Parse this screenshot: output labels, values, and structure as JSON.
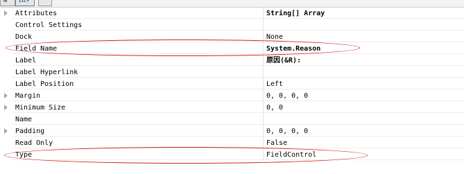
{
  "toolbar": {
    "buttons": [
      {
        "name": "categorized-view-button",
        "icon": "categorized-icon",
        "glyph": "⊞"
      },
      {
        "name": "alphabetical-view-button",
        "icon": "sort-az-icon",
        "glyph": "ǲ▾"
      },
      {
        "name": "property-pages-button",
        "icon": "property-pages-icon",
        "glyph": ""
      }
    ]
  },
  "properties": [
    {
      "name": "Attributes",
      "value": "String[] Array",
      "expandable": true,
      "bold_value": true
    },
    {
      "name": "Control Settings",
      "value": "",
      "expandable": false,
      "bold_value": false
    },
    {
      "name": "Dock",
      "value": "None",
      "expandable": false,
      "bold_value": false
    },
    {
      "name": "Field Name",
      "value": "System.Reason",
      "expandable": false,
      "bold_value": true,
      "highlighted": true
    },
    {
      "name": "Label",
      "value": "原因(&R):",
      "expandable": false,
      "bold_value": true
    },
    {
      "name": "Label Hyperlink",
      "value": "",
      "expandable": false,
      "bold_value": false
    },
    {
      "name": "Label Position",
      "value": "Left",
      "expandable": false,
      "bold_value": false
    },
    {
      "name": "Margin",
      "value": "0, 0, 0, 0",
      "expandable": true,
      "bold_value": false
    },
    {
      "name": "Minimum Size",
      "value": "0, 0",
      "expandable": true,
      "bold_value": false
    },
    {
      "name": "Name",
      "value": "",
      "expandable": false,
      "bold_value": false
    },
    {
      "name": "Padding",
      "value": "0, 0, 0, 0",
      "expandable": true,
      "bold_value": false
    },
    {
      "name": "Read Only",
      "value": "False",
      "expandable": false,
      "bold_value": false
    },
    {
      "name": "Type",
      "value": "FieldControl",
      "expandable": false,
      "bold_value": false,
      "highlighted": true
    }
  ],
  "colors": {
    "highlight_ellipse": "#d42020",
    "expander": "#a7a7a7",
    "grid_line": "#ececec"
  }
}
